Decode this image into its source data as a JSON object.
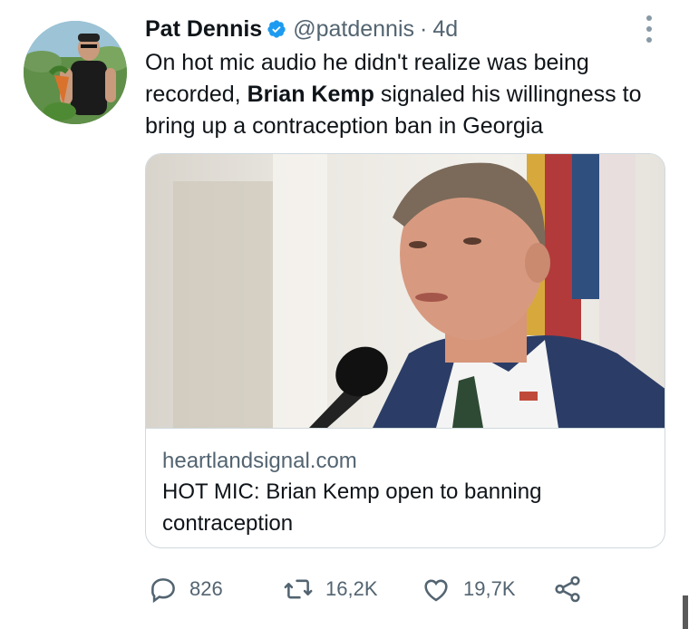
{
  "tweet": {
    "author_name": "Pat Dennis",
    "handle": "@patdennis",
    "separator": "·",
    "time": "4d",
    "text_part1": "On hot mic audio he didn't realize was being recorded, ",
    "text_bold": "Brian Kemp",
    "text_part2": " signaled his willingness to bring up a contraception ban in Georgia"
  },
  "card": {
    "domain": "heartlandsignal.com",
    "title": "HOT MIC: Brian Kemp open to banning contraception"
  },
  "actions": {
    "replies": "826",
    "retweets": "16,2K",
    "likes": "19,7K"
  },
  "colors": {
    "verified": "#1d9bf0",
    "secondary_text": "#536471",
    "border": "#cfd9de"
  }
}
